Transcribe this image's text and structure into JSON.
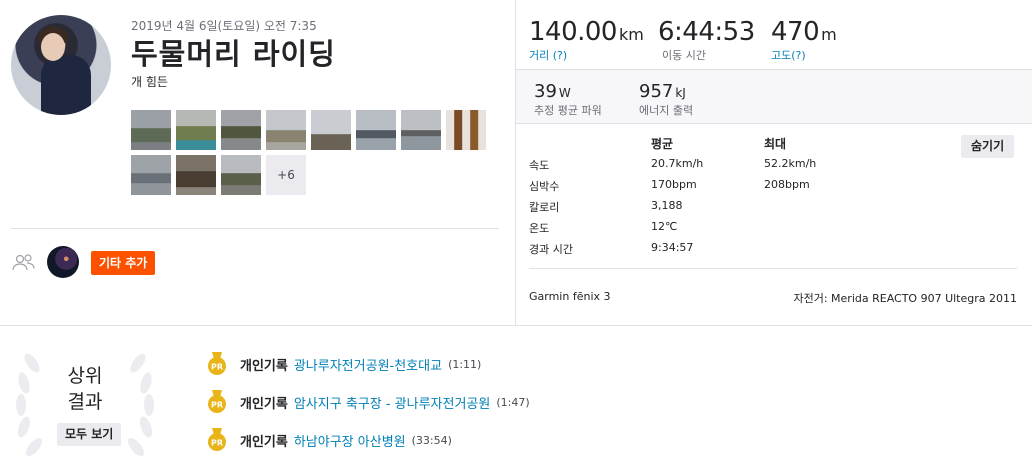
{
  "activity": {
    "date": "2019년 4월 6일(토요일) 오전 7:35",
    "title": "두물머리 라이딩",
    "description": "개 힘든"
  },
  "photos": {
    "more_label": "+6"
  },
  "actions": {
    "add_other_label": "기타 추가"
  },
  "stats": {
    "distance": {
      "value": "140.00",
      "unit": "km",
      "label": "거리 (?)"
    },
    "moving_time": {
      "value": "6:44:53",
      "label": "이동 시간"
    },
    "elevation": {
      "value": "470",
      "unit": "m",
      "label": "고도(?)"
    },
    "power": {
      "value": "39",
      "unit": "W",
      "label": "추정 평균 파워"
    },
    "energy": {
      "value": "957",
      "unit": "kJ",
      "label": "에너지 출력"
    }
  },
  "details": {
    "hide_label": "숨기기",
    "headers": {
      "avg": "평균",
      "max": "최대"
    },
    "rows": [
      {
        "label": "속도",
        "avg": "20.7km/h",
        "max": "52.2km/h"
      },
      {
        "label": "심박수",
        "avg": "170bpm",
        "max": "208bpm"
      },
      {
        "label": "칼로리",
        "avg": "3,188",
        "max": ""
      },
      {
        "label": "온도",
        "avg": "12℃",
        "max": ""
      },
      {
        "label": "경과 시간",
        "avg": "9:34:57",
        "max": ""
      }
    ]
  },
  "gear": {
    "device": "Garmin fēnix 3",
    "bike": "자전거: Merida REACTO 907 Ultegra 2011"
  },
  "achievements": {
    "top_results": [
      "상위",
      "결과"
    ],
    "view_all_label": "모두 보기",
    "items": [
      {
        "badge": "PR",
        "label": "개인기록",
        "segment": "광나루자전거공원-천호대교",
        "time": "(1:11)"
      },
      {
        "badge": "PR",
        "label": "개인기록",
        "segment": "암사지구 축구장 - 광나루자전거공원",
        "time": "(1:47)"
      },
      {
        "badge": "PR",
        "label": "개인기록",
        "segment": "하남야구장 아산병원",
        "time": "(33:54)"
      }
    ]
  },
  "colors": {
    "accent": "#fc5200",
    "link": "#007fb6",
    "badge_gold": "#e8b417"
  }
}
